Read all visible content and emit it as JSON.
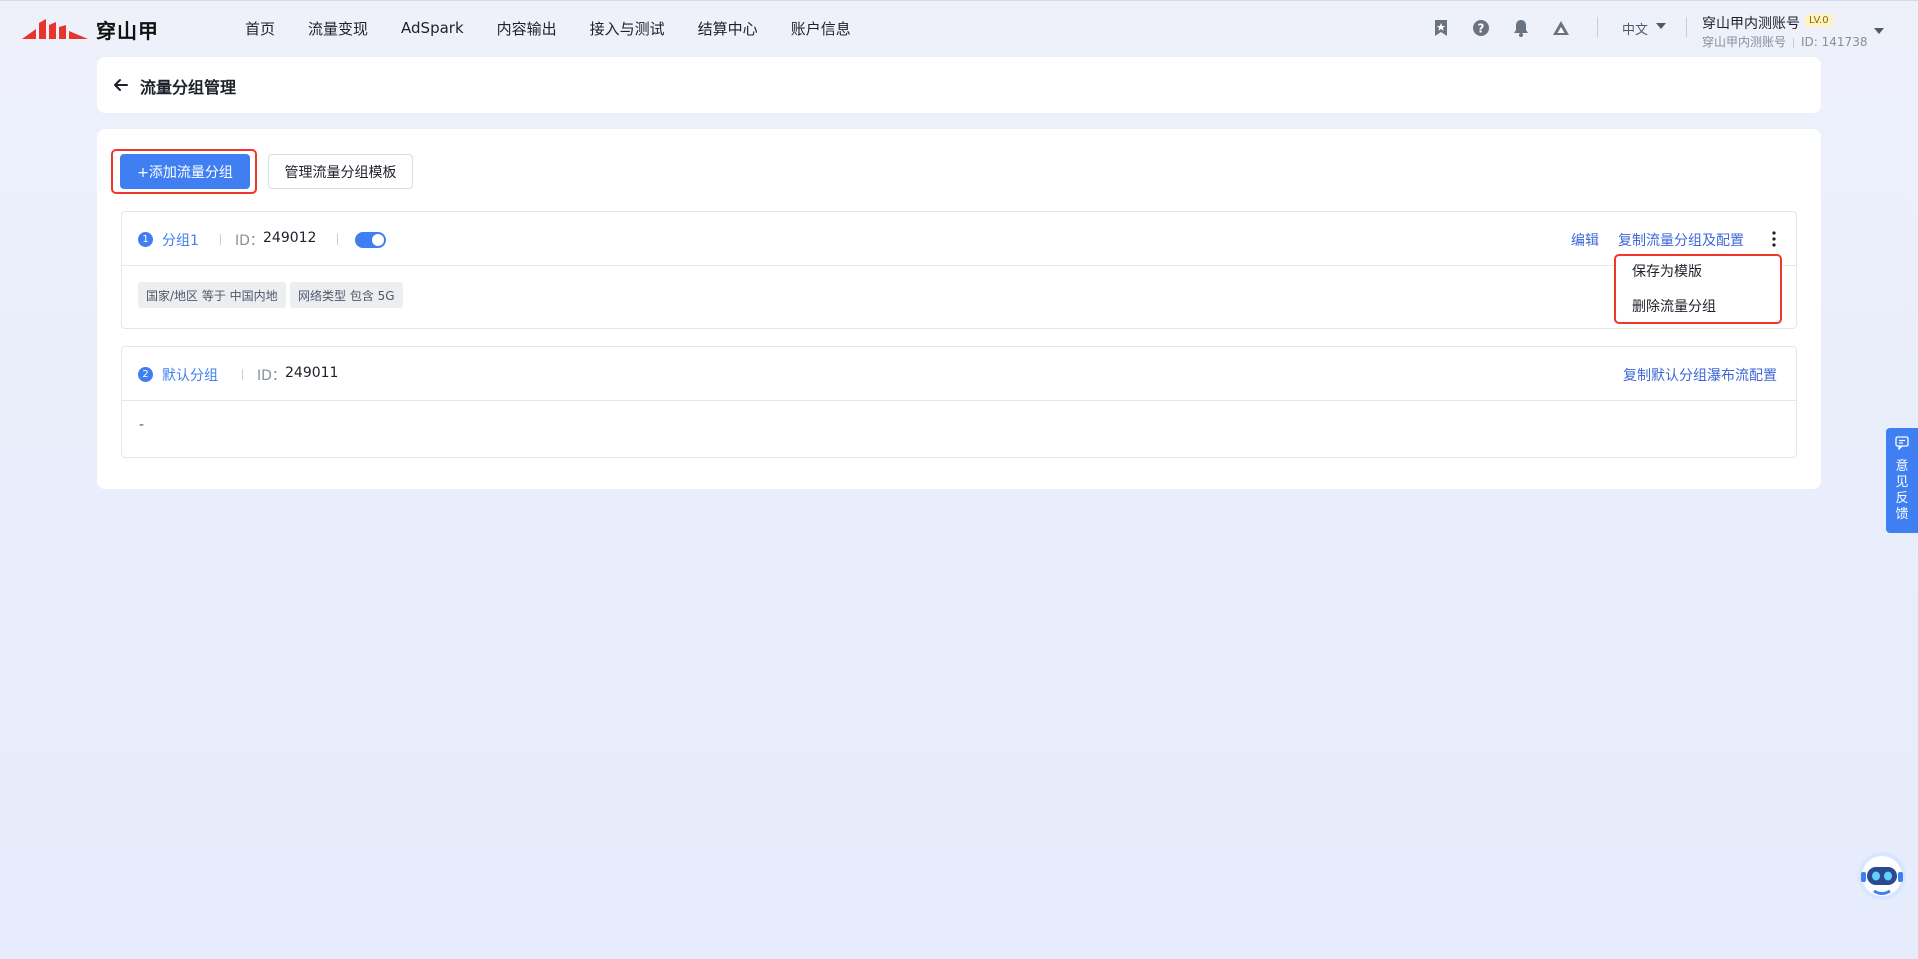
{
  "brand": {
    "name": "穿山甲",
    "accent": "#3f7ff2",
    "logo_red": "#e8352b"
  },
  "nav": {
    "items": [
      "首页",
      "流量变现",
      "AdSpark",
      "内容输出",
      "接入与测试",
      "结算中心",
      "账户信息"
    ]
  },
  "top_right": {
    "icons": [
      "bookmark-star-icon",
      "help-icon",
      "bell-icon",
      "mountain-icon"
    ],
    "language": "中文",
    "account_name": "穿山甲内测账号",
    "level": "LV.0",
    "account_sub": "穿山甲内测账号",
    "account_id": "ID: 141738"
  },
  "header": {
    "title": "流量分组管理"
  },
  "toolbar": {
    "add_label": "+添加流量分组",
    "template_label": "管理流量分组模板"
  },
  "groups": [
    {
      "index": "1",
      "name": "分组1",
      "id_label": "ID：",
      "id": "249012",
      "enabled": true,
      "actions": [
        "编辑",
        "复制流量分组及配置"
      ],
      "tags": [
        "国家/地区 等于 中国内地",
        "网络类型 包含 5G"
      ]
    },
    {
      "index": "2",
      "name": "默认分组",
      "id_label": "ID：",
      "id": "249011",
      "actions": [
        "复制默认分组瀑布流配置"
      ],
      "body_text": "-"
    }
  ],
  "dropdown": {
    "items": [
      "保存为模版",
      "删除流量分组"
    ]
  },
  "feedback": {
    "label": "意见反馈"
  }
}
